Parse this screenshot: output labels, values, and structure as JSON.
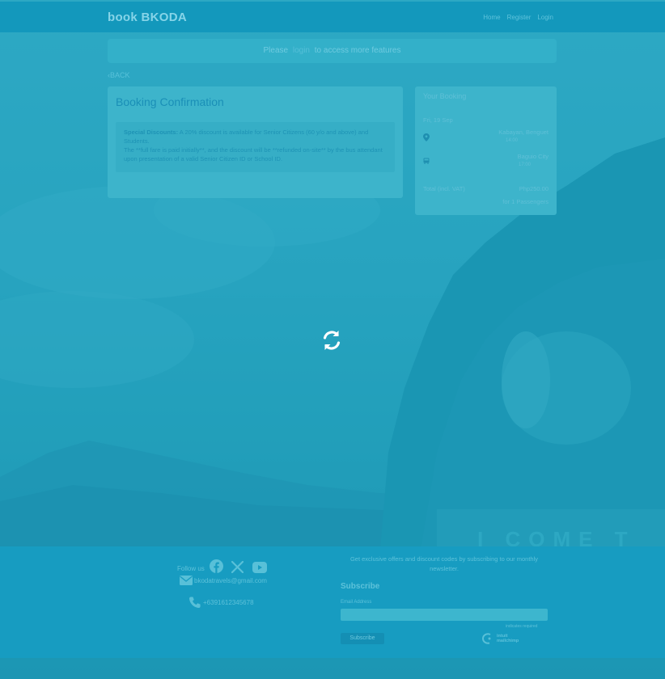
{
  "header": {
    "brand": "book BKODA",
    "links": [
      "Home",
      "Register",
      "Login"
    ]
  },
  "notice": {
    "prefix": "Please",
    "link": "login",
    "suffix": "to access more features"
  },
  "back_label": "‹BACK",
  "confirmation": {
    "title": "Booking Confirmation",
    "special_label": "Special Discounts:",
    "special_text": " A 20% discount is available for Senior Citizens (60 y/o and above) and Students.",
    "refund_text": "The **full fare is paid initially**, and the discount will be **refunded on-site** by the bus attendant upon presentation of a valid Senior Citizen ID or School ID."
  },
  "booking": {
    "title": "Your Booking",
    "date": "Fri, 19 Sep",
    "origin": "Kabayan, Benguet",
    "origin_time": "14:00",
    "destination": "Baguio City",
    "destination_time": "17:00",
    "total_label": "Total (incl. VAT)",
    "total_value": "Php250.00",
    "passengers": "for 1 Passengers"
  },
  "footer": {
    "follow_label": "Follow us",
    "email": "bkodatravels@gmail.com",
    "phone": "+6391612345678",
    "promo": "Get exclusive offers and discount codes by subscribing to our monthly newsletter.",
    "subscribe_title": "Subscribe",
    "email_label": "Email Address",
    "required_note": "indicates required",
    "subscribe_button": "Subscribe",
    "mailchimp_line1": "intuit",
    "mailchimp_line2": "mailchimp"
  },
  "colors": {
    "nav": "#1398bc",
    "footer": "#179cc1",
    "card": "#3db4cb",
    "accent": "#1a8fb7"
  },
  "icons": [
    "map-pin-icon",
    "bus-icon",
    "refresh-spinner-icon",
    "facebook-icon",
    "x-icon",
    "youtube-icon",
    "envelope-icon",
    "phone-icon",
    "mailchimp-logo-icon"
  ]
}
